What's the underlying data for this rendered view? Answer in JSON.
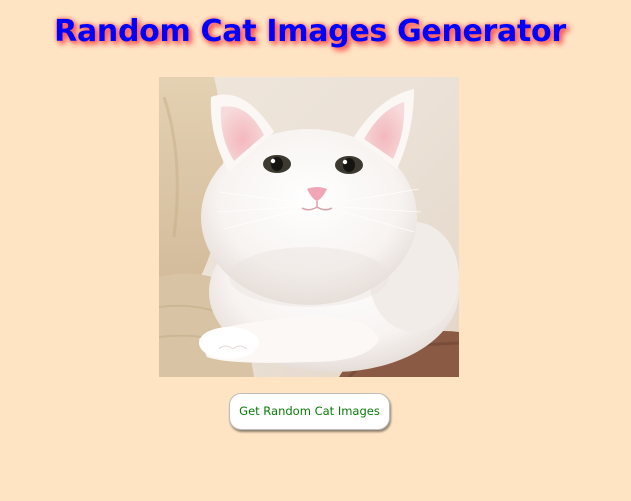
{
  "header": {
    "title": "Random Cat Images Generator",
    "title_color": "#0000ff",
    "title_glow_color": "#ff3b3b"
  },
  "image": {
    "subject": "white cat lying on a beige sofa"
  },
  "actions": {
    "get_button_label": "Get Random Cat Images",
    "button_text_color": "#0a7a0a"
  },
  "page": {
    "background_color": "#ffe4c4"
  }
}
